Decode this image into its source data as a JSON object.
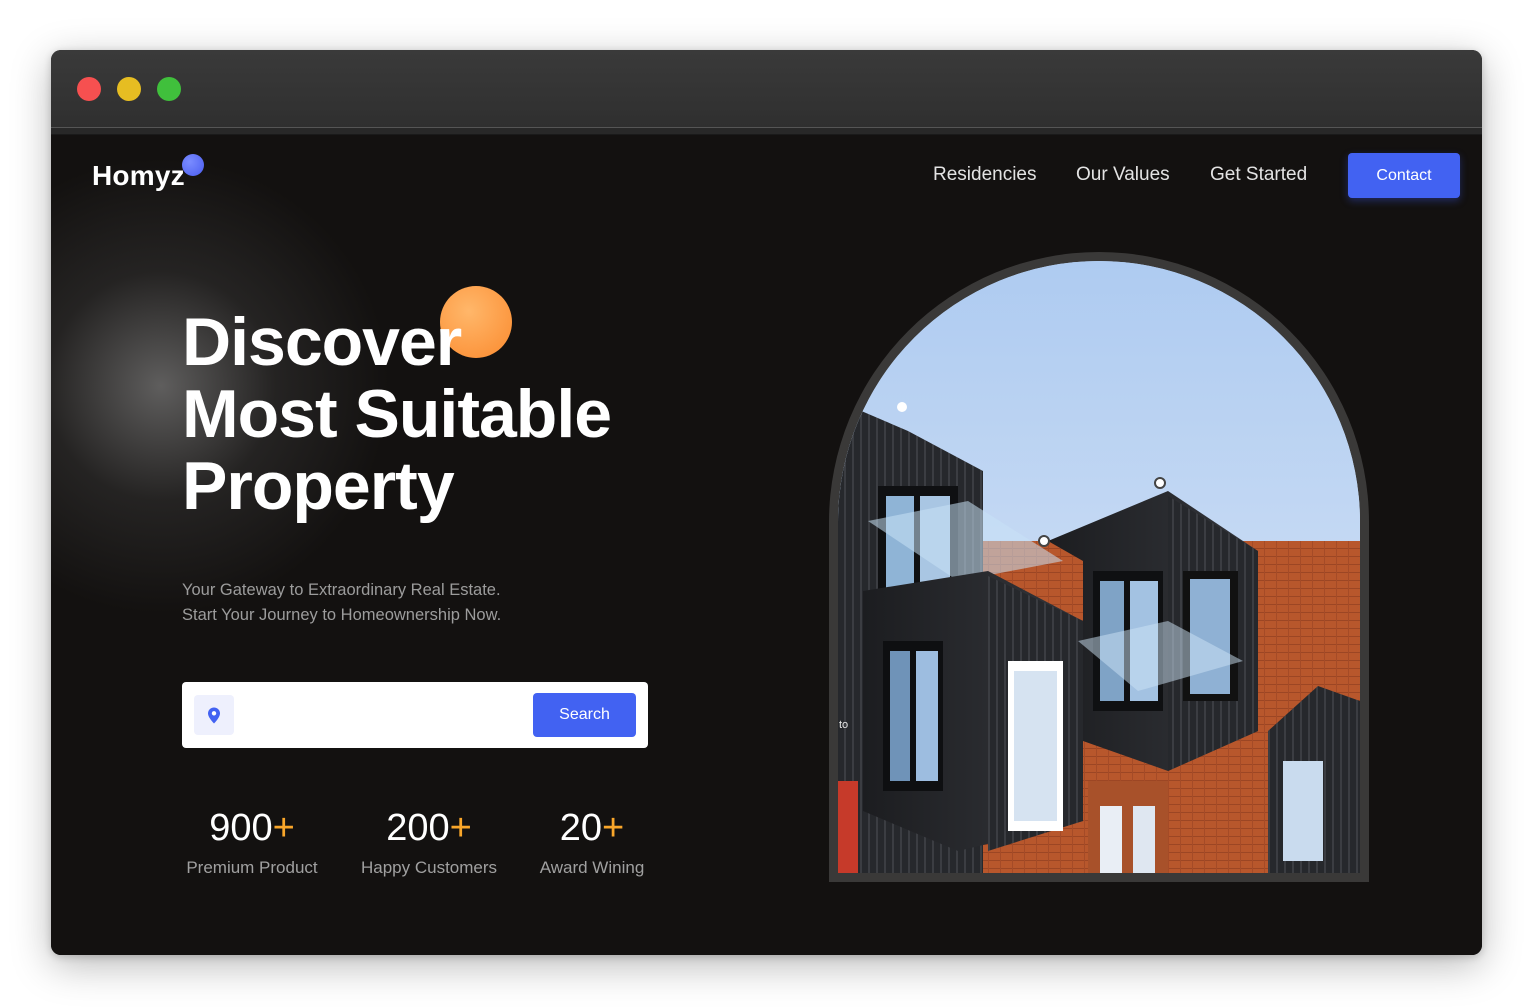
{
  "window": {
    "controls": [
      "close",
      "minimize",
      "maximize"
    ]
  },
  "brand": {
    "logo_text": "Homyz",
    "accent_color": "#4262f2",
    "orange_color": "#f9a62a"
  },
  "nav": {
    "links": [
      "Residencies",
      "Our Values",
      "Get Started"
    ],
    "contact_label": "Contact"
  },
  "hero": {
    "headline_lines": [
      "Discover",
      "Most Suitable",
      "Property"
    ],
    "subtext_lines": [
      "Your Gateway to Extraordinary Real Estate.",
      "Start Your Journey to Homeownership Now."
    ],
    "search": {
      "icon": "location-pin-icon",
      "placeholder": "",
      "value": "",
      "button_label": "Search"
    },
    "stats": [
      {
        "number": "900",
        "suffix": "+",
        "label": "Premium Product"
      },
      {
        "number": "200",
        "suffix": "+",
        "label": "Happy Customers"
      },
      {
        "number": "20",
        "suffix": "+",
        "label": "Award Wining"
      }
    ],
    "image_alt_fragment": "to"
  }
}
